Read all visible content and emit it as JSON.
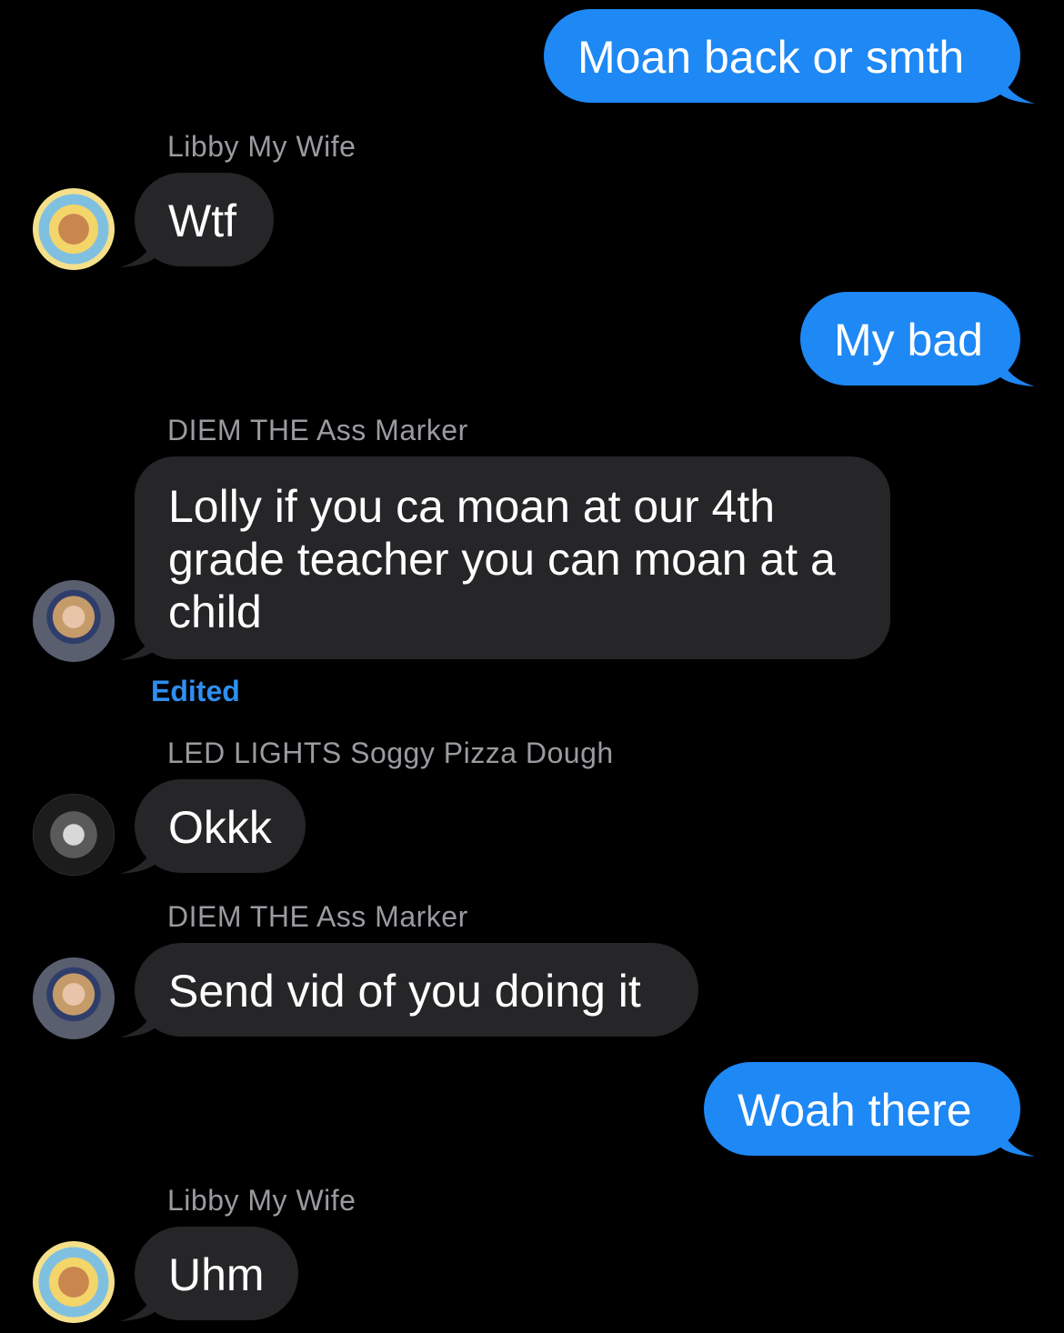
{
  "messages": [
    {
      "direction": "outgoing",
      "text": "Moan back or smth"
    },
    {
      "sender": "Libby My Wife",
      "direction": "incoming",
      "text": "Wtf",
      "avatar": "avatar-sun-icon"
    },
    {
      "direction": "outgoing",
      "text": "My bad"
    },
    {
      "sender": "DIEM THE Ass Marker",
      "direction": "incoming",
      "lines": [
        "Lolly if you ca moan at our 4th",
        "grade teacher you can moan at a",
        "child"
      ],
      "avatar": "avatar-girl-icon",
      "status": "Edited"
    },
    {
      "sender": "LED LIGHTS Soggy Pizza Dough",
      "direction": "incoming",
      "text": "Okkk",
      "avatar": "avatar-bw-icon"
    },
    {
      "sender": "DIEM THE Ass Marker",
      "direction": "incoming",
      "text": "Send vid of you doing it",
      "avatar": "avatar-girl-icon"
    },
    {
      "direction": "outgoing",
      "text": "Woah there"
    },
    {
      "sender": "Libby My Wife",
      "direction": "incoming",
      "text": "Uhm",
      "avatar": "avatar-sun-icon"
    }
  ],
  "colors": {
    "background": "#000000",
    "outgoing_bubble": "#1e88f5",
    "incoming_bubble": "#262628",
    "sender_text": "#9a9aa0",
    "edited_text": "#2f8ff0"
  }
}
